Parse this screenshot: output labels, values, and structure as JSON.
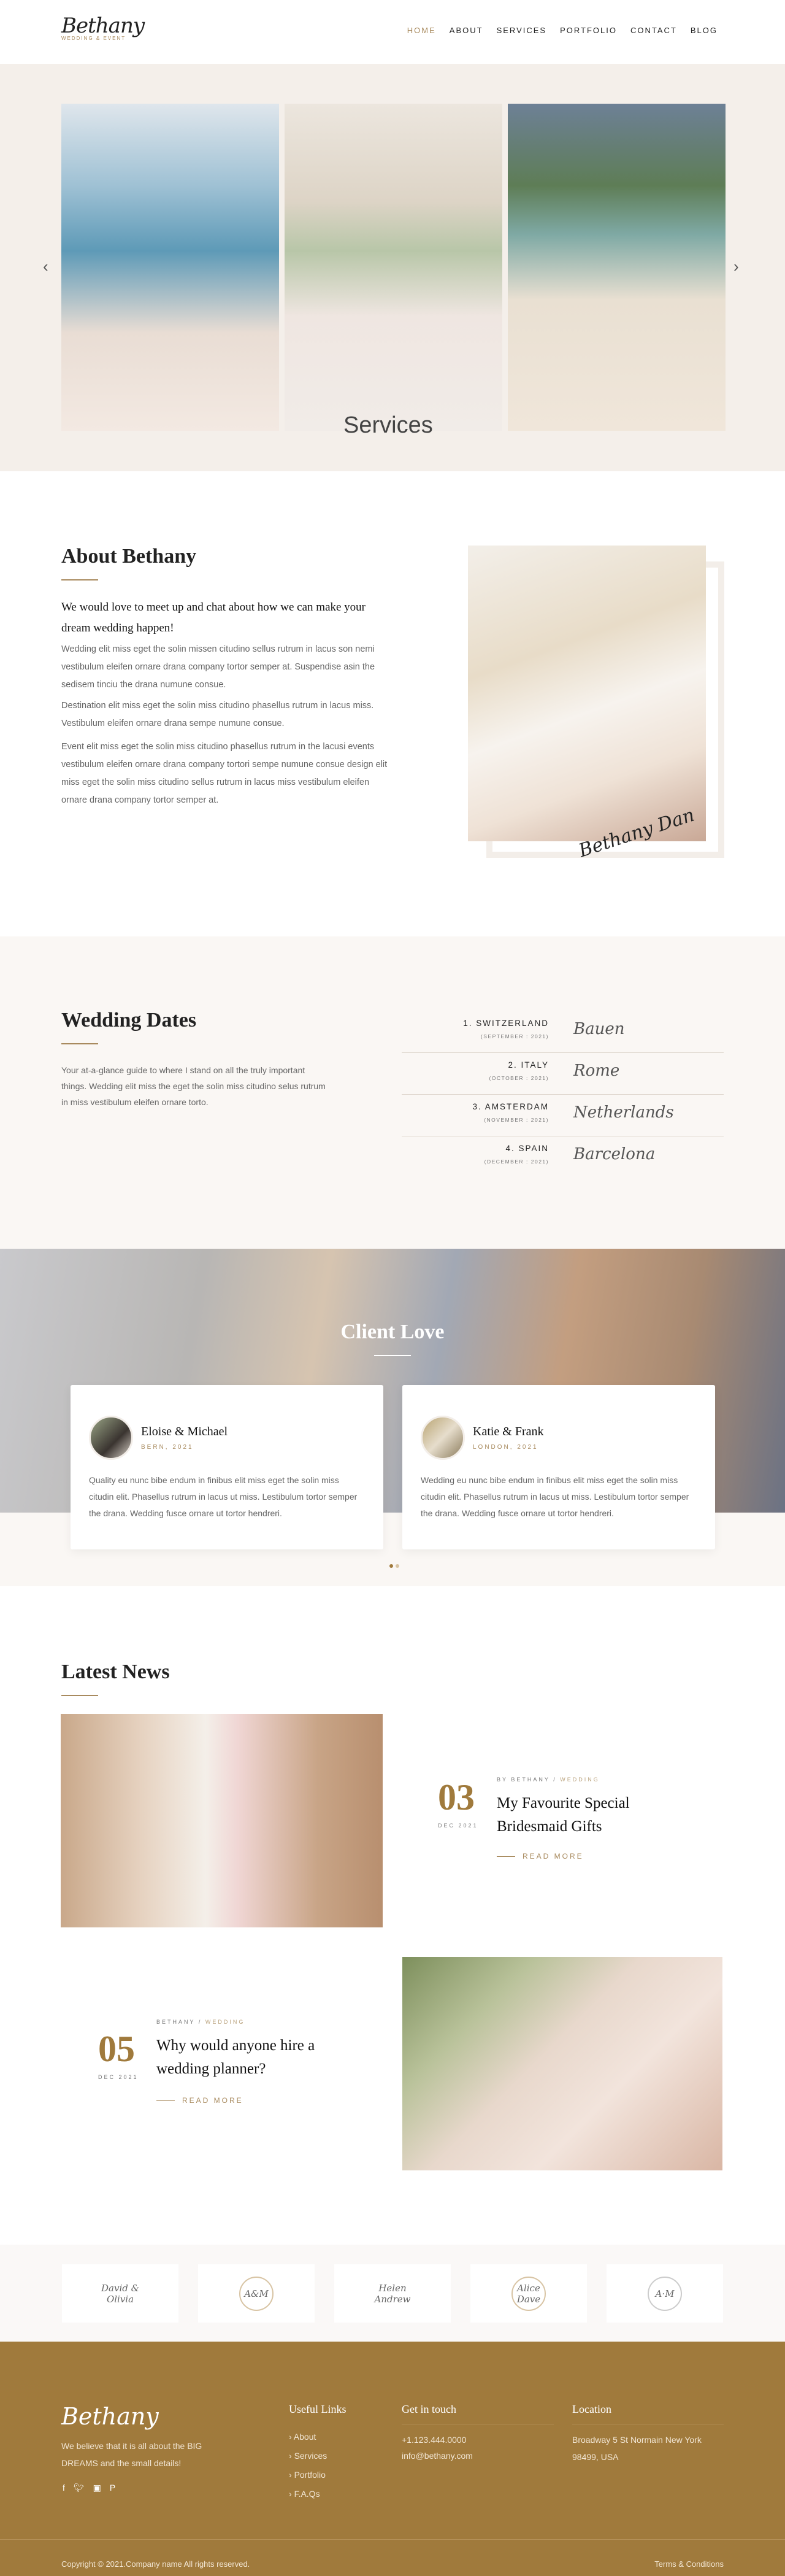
{
  "header": {
    "logo": "Bethany",
    "logo_sub": "WEDDING & EVENT",
    "nav": [
      {
        "label": "HOME",
        "active": true
      },
      {
        "label": "ABOUT"
      },
      {
        "label": "SERVICES"
      },
      {
        "label": "PORTFOLIO"
      },
      {
        "label": "CONTACT"
      },
      {
        "label": "BLOG"
      }
    ]
  },
  "hero": {
    "script_label": "Services",
    "prev_icon": "chevron-left-icon",
    "next_icon": "chevron-right-icon"
  },
  "about": {
    "title": "About Bethany",
    "lead": "We would love to meet up and chat about how we can make your dream wedding happen!",
    "paragraphs": [
      "Wedding elit miss eget the solin missen citudino sellus rutrum in lacus son nemi vestibulum eleifen ornare drana company tortor semper at. Suspendise asin the sedisem tinciu the drana numune consue.",
      "Destination elit miss eget the solin miss citudino phasellus rutrum in lacus miss. Vestibulum eleifen ornare drana sempe numune consue.",
      "Event elit miss eget the solin miss citudino phasellus rutrum in the lacusi events vestibulum eleifen ornare drana company tortori sempe numune consue design elit miss eget the solin miss citudino sellus rutrum in lacus miss vestibulum eleifen ornare drana company tortor semper at."
    ],
    "signature": "Bethany Dan"
  },
  "dates": {
    "title": "Wedding Dates",
    "text": "Your at-a-glance guide to where I stand on all the truly important things. Wedding elit miss the eget the solin miss citudino selus rutrum in miss vestibulum eleifen ornare torto.",
    "items": [
      {
        "country": "1. SWITZERLAND",
        "month": "(SEPTEMBER : 2021)",
        "city": "Bauen"
      },
      {
        "country": "2. ITALY",
        "month": "(OCTOBER : 2021)",
        "city": "Rome"
      },
      {
        "country": "3. AMSTERDAM",
        "month": "(NOVEMBER : 2021)",
        "city": "Netherlands"
      },
      {
        "country": "4. SPAIN",
        "month": "(DECEMBER : 2021)",
        "city": "Barcelona"
      }
    ]
  },
  "client_love": {
    "title": "Client Love",
    "testimonials": [
      {
        "name": "Eloise & Michael",
        "location": "BERN, 2021",
        "text": "Quality eu nunc bibe endum in finibus elit miss eget the solin miss citudin elit. Phasellus rutrum in lacus ut miss. Lestibulum tortor semper the drana. Wedding fusce ornare ut tortor hendreri."
      },
      {
        "name": "Katie & Frank",
        "location": "LONDON, 2021",
        "text": "Wedding eu nunc bibe endum in finibus elit miss eget the solin miss citudin elit. Phasellus rutrum in lacus ut miss. Lestibulum tortor semper the drana. Wedding fusce ornare ut tortor hendreri."
      }
    ],
    "active_dot": 0
  },
  "news": {
    "title": "Latest News",
    "posts": [
      {
        "day": "03",
        "month": "DEC 2021",
        "meta_author": "BY BETHANY / ",
        "meta_cat": "WEDDING",
        "title": "My Favourite Special Bridesmaid Gifts",
        "read_more": "READ MORE"
      },
      {
        "day": "05",
        "month": "DEC 2021",
        "meta_author": "BETHANY / ",
        "meta_cat": "WEDDING",
        "title": "Why would anyone hire a wedding planner?",
        "read_more": "READ MORE"
      }
    ]
  },
  "clients": [
    {
      "line1": "David &",
      "line2": "Olivia"
    },
    {
      "line1": "A&M",
      "line2": ""
    },
    {
      "line1": "Helen",
      "line2": "Andrew"
    },
    {
      "line1": "Alice",
      "line2": "Dave"
    },
    {
      "line1": "A·M",
      "line2": ""
    }
  ],
  "footer": {
    "logo": "Bethany",
    "tagline": "We believe that it is all about the BIG DREAMS and the small details!",
    "social": [
      "facebook-icon",
      "twitter-icon",
      "instagram-icon",
      "pinterest-icon"
    ],
    "links_title": "Useful Links",
    "links": [
      "About",
      "Services",
      "Portfolio",
      "F.A.Qs"
    ],
    "contact_title": "Get in touch",
    "phone": "+1.123.444.0000",
    "email": "info@bethany.com",
    "location_title": "Location",
    "address": "Broadway 5 St Normain New York 98499, USA",
    "copyright": "Copyright © 2021.Company name All rights reserved.",
    "terms": "Terms & Conditions"
  },
  "colors": {
    "accent": "#a88a5e",
    "footer_bg": "#a07a3c",
    "section_bg": "#faf7f4",
    "hero_bg": "#f4efea"
  }
}
